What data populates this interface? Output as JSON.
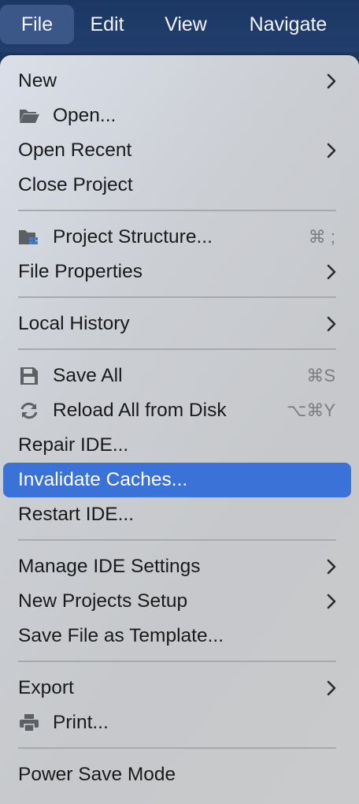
{
  "menubar": {
    "items": [
      {
        "label": "File",
        "active": true
      },
      {
        "label": "Edit"
      },
      {
        "label": "View"
      },
      {
        "label": "Navigate"
      }
    ]
  },
  "menu": {
    "highlight_color": "#3b72d8",
    "items": [
      {
        "label": "New",
        "submenu": true
      },
      {
        "label": "Open...",
        "icon": "folder-open-icon"
      },
      {
        "label": "Open Recent",
        "submenu": true
      },
      {
        "label": "Close Project"
      },
      {
        "label": "Project Structure...",
        "icon": "project-structure-icon",
        "shortcut": "⌘ ;"
      },
      {
        "label": "File Properties",
        "submenu": true
      },
      {
        "label": "Local History",
        "submenu": true
      },
      {
        "label": "Save All",
        "icon": "save-icon",
        "shortcut": "⌘S"
      },
      {
        "label": "Reload All from Disk",
        "icon": "reload-icon",
        "shortcut": "⌥⌘Y"
      },
      {
        "label": "Repair IDE..."
      },
      {
        "label": "Invalidate Caches...",
        "highlighted": true
      },
      {
        "label": "Restart IDE..."
      },
      {
        "label": "Manage IDE Settings",
        "submenu": true
      },
      {
        "label": "New Projects Setup",
        "submenu": true
      },
      {
        "label": "Save File as Template..."
      },
      {
        "label": "Export",
        "submenu": true
      },
      {
        "label": "Print...",
        "icon": "printer-icon"
      },
      {
        "label": "Power Save Mode"
      }
    ]
  }
}
